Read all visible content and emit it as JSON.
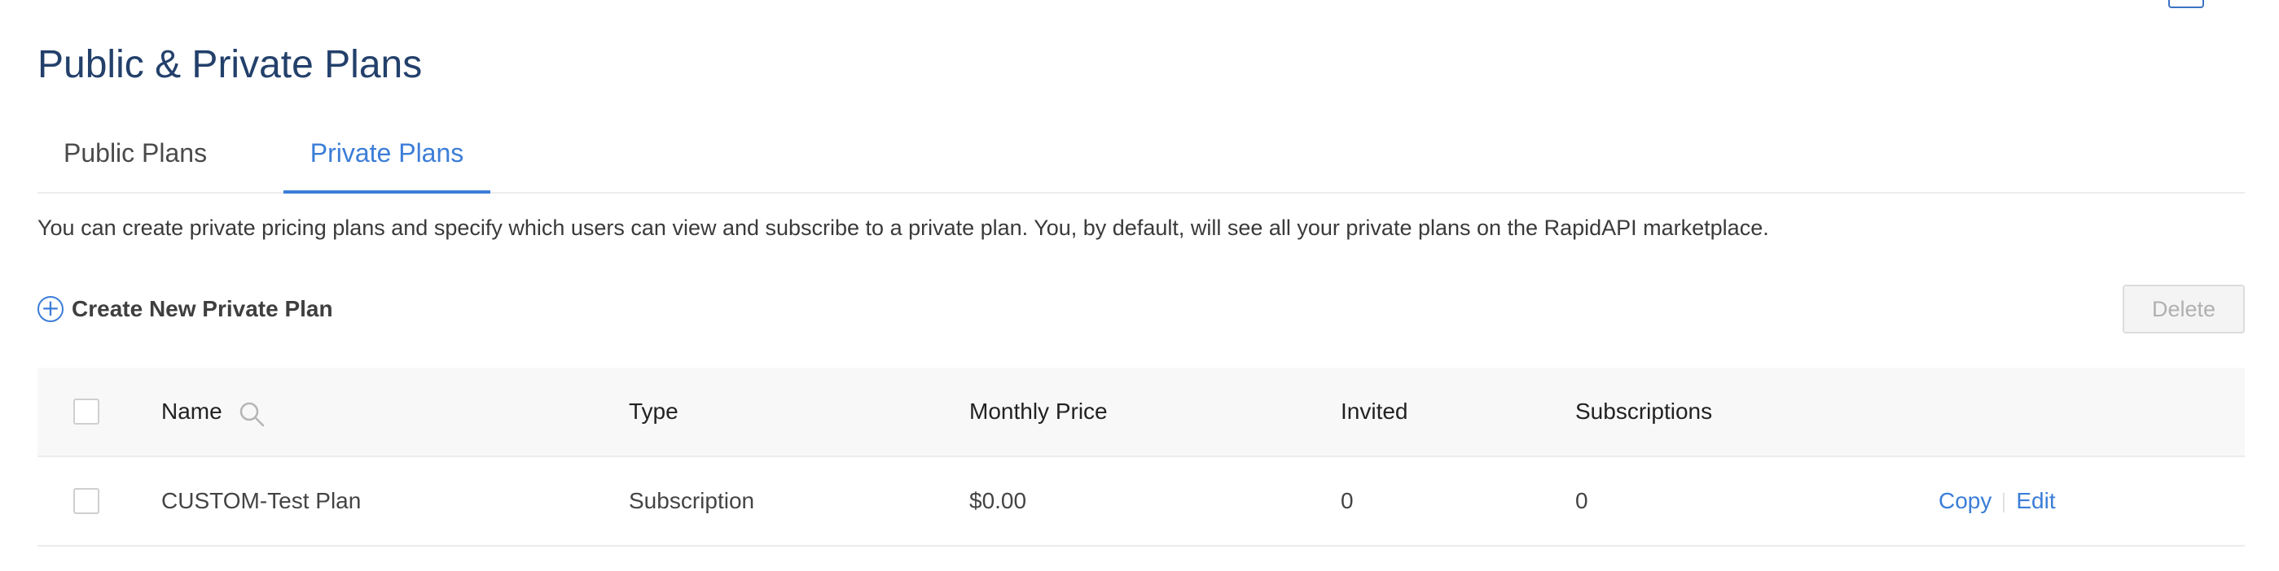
{
  "page": {
    "title": "Public & Private Plans"
  },
  "tabs": [
    {
      "label": "Public Plans",
      "active": false
    },
    {
      "label": "Private Plans",
      "active": true
    }
  ],
  "description": "You can create private pricing plans and specify which users can view and subscribe to a private plan. You, by default, will see all your private plans on the RapidAPI marketplace.",
  "toolbar": {
    "create_label": "Create New Private Plan",
    "create_icon": "plus-circle-icon",
    "delete_label": "Delete"
  },
  "table": {
    "columns": [
      "Name",
      "Type",
      "Monthly Price",
      "Invited",
      "Subscriptions"
    ],
    "rows": [
      {
        "name": "CUSTOM-Test Plan",
        "type": "Subscription",
        "monthly_price": "$0.00",
        "invited": "0",
        "subscriptions": "0",
        "actions": [
          "Copy",
          "Edit"
        ]
      }
    ]
  },
  "colors": {
    "accent": "#3b7dd8",
    "title": "#23406b"
  }
}
